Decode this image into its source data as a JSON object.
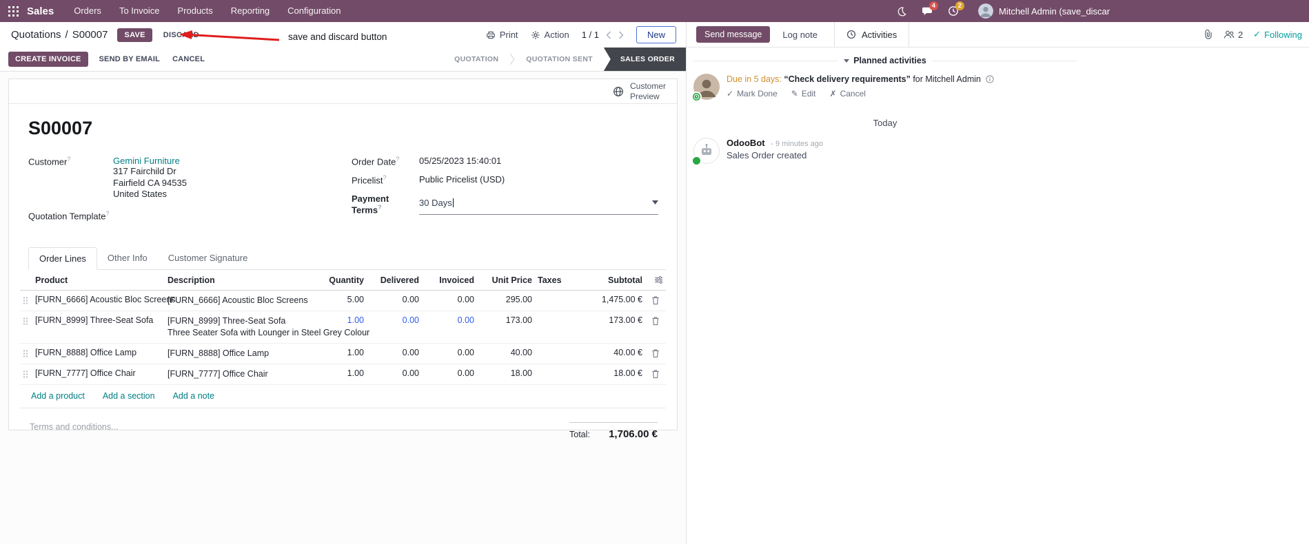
{
  "navbar": {
    "app_name": "Sales",
    "menus": [
      "Orders",
      "To Invoice",
      "Products",
      "Reporting",
      "Configuration"
    ],
    "message_badge": "4",
    "activity_badge": "2",
    "user_name": "Mitchell Admin (save_discar"
  },
  "control_panel": {
    "breadcrumb": {
      "parent": "Quotations",
      "separator": "/",
      "current": "S00007"
    },
    "save": "SAVE",
    "discard": "DISCARD",
    "print": "Print",
    "action": "Action",
    "pager": "1 / 1",
    "new": "New"
  },
  "annotation": {
    "label": "save and discard button"
  },
  "statusbar": {
    "create_invoice": "CREATE INVOICE",
    "send_by_email": "SEND BY EMAIL",
    "cancel": "CANCEL",
    "stages": [
      {
        "label": "QUOTATION"
      },
      {
        "label": "QUOTATION SENT"
      },
      {
        "label": "SALES ORDER"
      }
    ]
  },
  "sheet": {
    "customer_preview_line1": "Customer",
    "customer_preview_line2": "Preview",
    "title": "S00007",
    "help_marker": "?",
    "customer": {
      "label": "Customer",
      "name": "Gemini Furniture",
      "address": [
        "317 Fairchild Dr",
        "Fairfield CA 94535",
        "United States"
      ]
    },
    "quotation_template_label": "Quotation Template",
    "order_date": {
      "label": "Order Date",
      "value": "05/25/2023 15:40:01"
    },
    "pricelist": {
      "label": "Pricelist",
      "value": "Public Pricelist (USD)"
    },
    "payment_terms": {
      "label": "Payment Terms",
      "value": "30 Days"
    },
    "tabs": [
      {
        "label": "Order Lines"
      },
      {
        "label": "Other Info"
      },
      {
        "label": "Customer Signature"
      }
    ],
    "order_lines": {
      "headers": [
        "Product",
        "Description",
        "Quantity",
        "Delivered",
        "Invoiced",
        "Unit Price",
        "Taxes",
        "Subtotal"
      ],
      "rows": [
        {
          "product": "[FURN_6666] Acoustic Bloc Screens",
          "description": "[FURN_6666] Acoustic Bloc Screens",
          "quantity": "5.00",
          "delivered": "0.00",
          "invoiced": "0.00",
          "unit_price": "295.00",
          "subtotal": "1,475.00 €"
        },
        {
          "product": "[FURN_8999] Three-Seat Sofa",
          "description": "[FURN_8999] Three-Seat Sofa",
          "description2": "Three Seater Sofa with Lounger in Steel Grey Colour",
          "quantity": "1.00",
          "delivered": "0.00",
          "invoiced": "0.00",
          "unit_price": "173.00",
          "subtotal": "173.00 €"
        },
        {
          "product": "[FURN_8888] Office Lamp",
          "description": "[FURN_8888] Office Lamp",
          "quantity": "1.00",
          "delivered": "0.00",
          "invoiced": "0.00",
          "unit_price": "40.00",
          "subtotal": "40.00 €"
        },
        {
          "product": "[FURN_7777] Office Chair",
          "description": "[FURN_7777] Office Chair",
          "quantity": "1.00",
          "delivered": "0.00",
          "invoiced": "0.00",
          "unit_price": "18.00",
          "subtotal": "18.00 €"
        }
      ],
      "add_product": "Add a product",
      "add_section": "Add a section",
      "add_note": "Add a note"
    },
    "terms_placeholder": "Terms and conditions...",
    "total": {
      "label": "Total:",
      "value": "1,706.00 €"
    }
  },
  "chatter": {
    "send_message": "Send message",
    "log_note": "Log note",
    "activities_tab": "Activities",
    "followers_count": "2",
    "following": "Following",
    "planned_header": "Planned activities",
    "activity": {
      "due": "Due in 5 days:",
      "summary": "“Check delivery requirements”",
      "assignee": "for Mitchell Admin",
      "mark_done": "Mark Done",
      "edit": "Edit",
      "cancel": "Cancel"
    },
    "day_divider": "Today",
    "message": {
      "author": "OdooBot",
      "time": "- 9 minutes ago",
      "body": "Sales Order created"
    }
  },
  "icons": {
    "check": "✓",
    "pencil": "✎",
    "cross": "✗"
  },
  "colors": {
    "brand": "#714B67",
    "link": "#017e84",
    "edited_value": "#2e5bf0",
    "stage_active_bg": "#43454d",
    "annotation_red": "#e01d1d",
    "due_future": "#cf8f2e",
    "following_teal": "#00a09d"
  }
}
